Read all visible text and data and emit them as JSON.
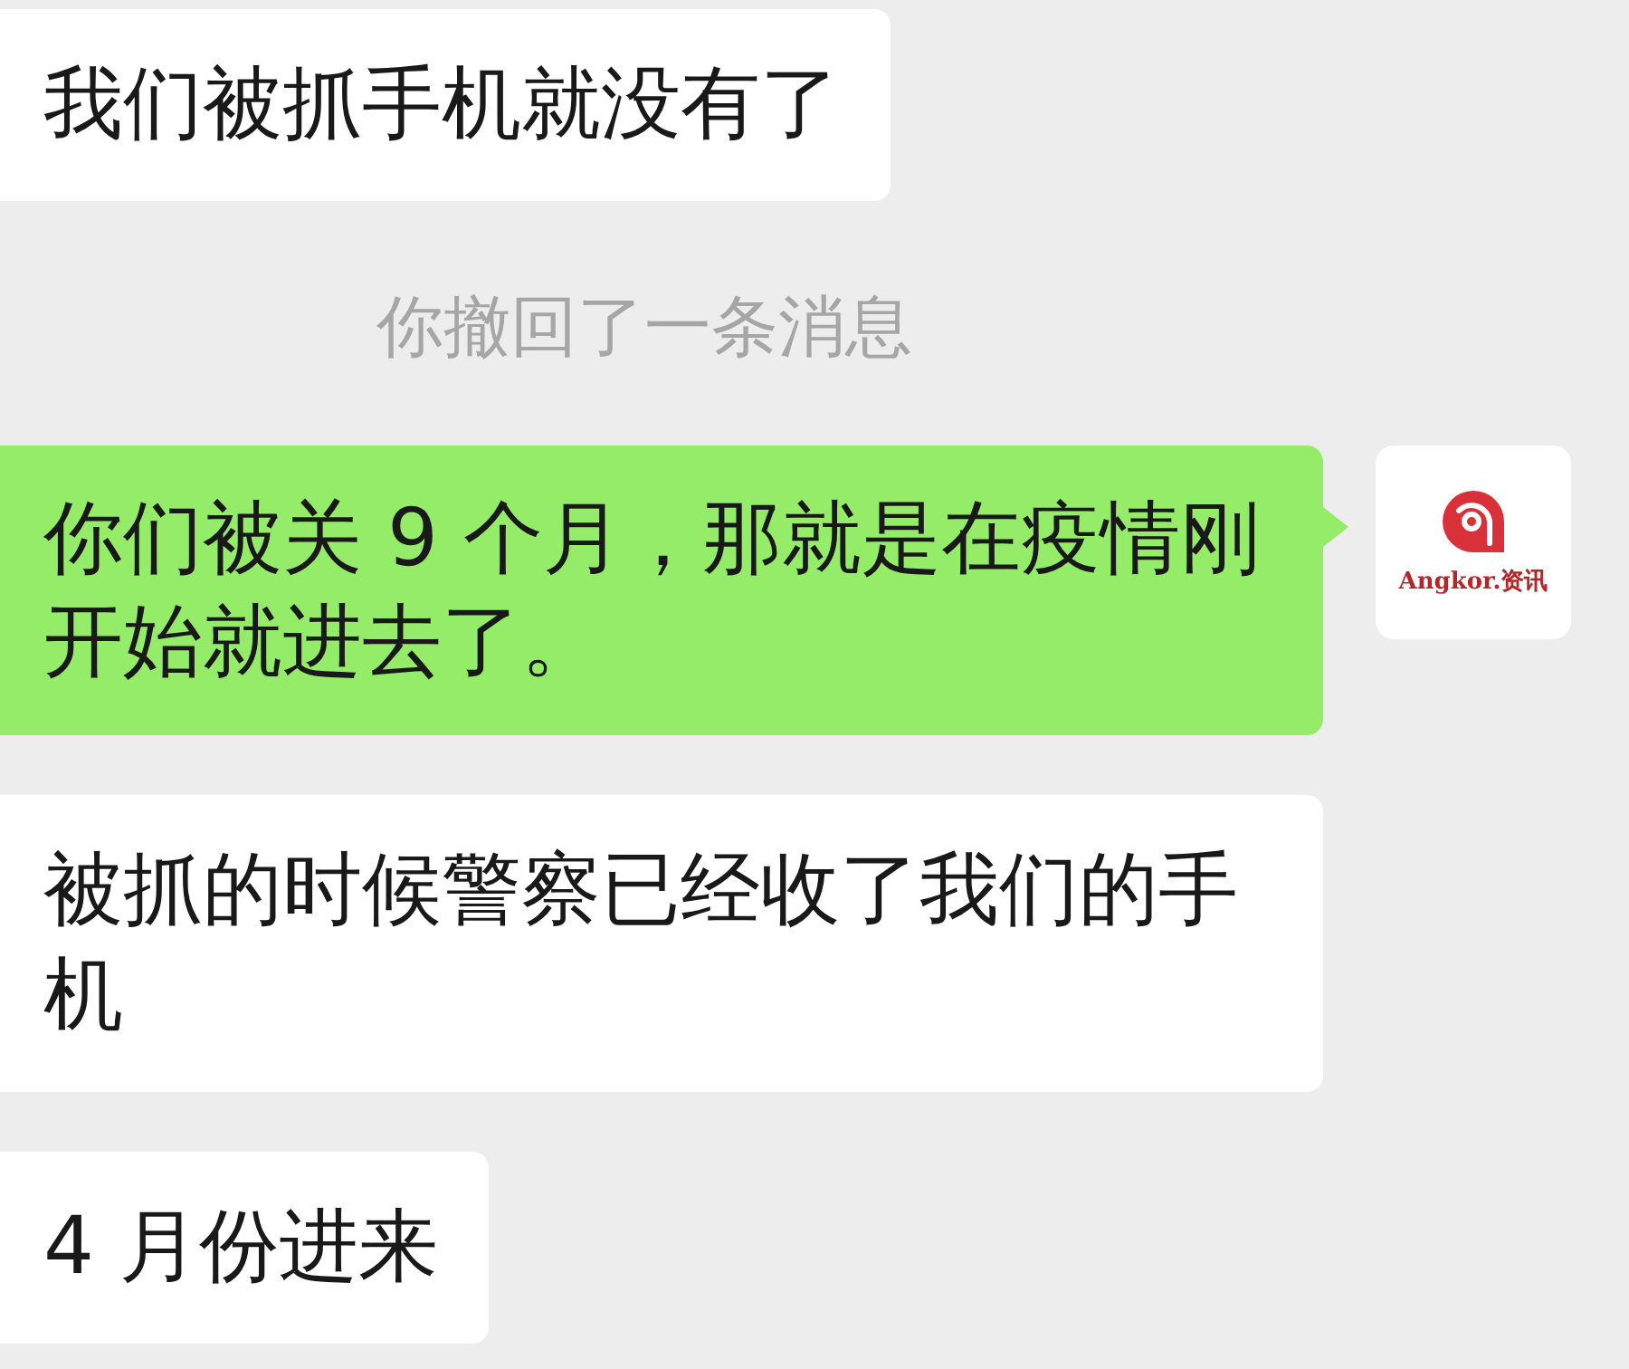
{
  "messages": [
    {
      "kind": "incoming",
      "text": "我们被抓手机就没有了"
    },
    {
      "kind": "notice",
      "text": "你撤回了一条消息"
    },
    {
      "kind": "outgoing",
      "text": "你们被关 9 个月，那就是在疫情刚开始就进去了。",
      "avatar": {
        "label": "Angkor.资讯"
      }
    },
    {
      "kind": "incoming",
      "text": "被抓的时候警察已经收了我们的手机"
    },
    {
      "kind": "incoming",
      "text": "4 月份进来"
    }
  ]
}
